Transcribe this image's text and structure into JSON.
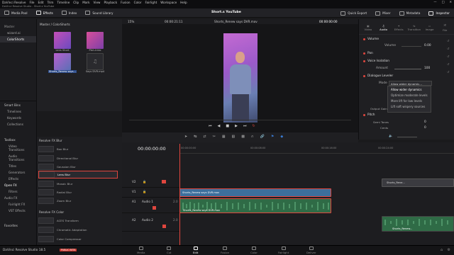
{
  "titlebar": {
    "app": "DaVinci Resolve Studio - Short.s YouTube",
    "menus": [
      "DaVinci Resolve",
      "File",
      "Edit",
      "Trim",
      "Timeline",
      "Clip",
      "Mark",
      "View",
      "Playback",
      "Fusion",
      "Color",
      "Fairlight",
      "Workspace",
      "Help"
    ]
  },
  "toolbar": {
    "left": [
      "Media Pool",
      "Effects",
      "Index",
      "Sound Library"
    ],
    "project_title": "Short.s YouTube",
    "right": [
      "Quick Export",
      "Mixer",
      "Metadata",
      "Inspector"
    ]
  },
  "left_pane": {
    "items": [
      "Master",
      "wizard.ai",
      "ColorShorts"
    ],
    "smart_bins_title": "Smart Bins",
    "smart_bins": [
      "Timelines",
      "Keywords",
      "Collections"
    ]
  },
  "media_pool": {
    "breadcrumb": "Master / ColorShorts",
    "clips": [
      "Lens Short",
      "Plsh-Intro",
      "Shorts_Renew says...",
      "Says DVR.mp4"
    ]
  },
  "viewer": {
    "zoom": "15%",
    "timecode_left": "00:00:21:11",
    "clip_name": "Shorts_Renew says DVR.mov",
    "timecode_right": "00:00:00:00"
  },
  "inspector": {
    "tabs": [
      "Video",
      "Audio",
      "Effects",
      "Transition",
      "Image",
      "File"
    ],
    "sections": [
      {
        "name": "Volume"
      },
      {
        "name": "Pan"
      },
      {
        "name": "Voice Isolation"
      },
      {
        "name": "Dialogue Leveler"
      },
      {
        "name": "Pitch"
      }
    ],
    "volume_label": "Volume",
    "volume_value": "0.00",
    "amount_label": "Amount",
    "amount_value": "100",
    "mode_label": "Mode",
    "mode_value": "Allow wider dynamic...",
    "output_gain_label": "Output Gain",
    "semitones_label": "Semi Tones",
    "semitones_value": "0",
    "cents_label": "Cents",
    "cents_value": "0",
    "mode_options": [
      "Allow wider dynamics",
      "Optimize moderate levels",
      "More lift for low levels",
      "Lift soft wispery sources"
    ]
  },
  "effects": {
    "sidebar": [
      "Toolbox",
      "Video Transitions",
      "Audio Transitions",
      "Titles",
      "Generators",
      "Effects",
      "Open FX",
      "Filters",
      "Audio FX",
      "Fairlight FX",
      "VST Effects"
    ],
    "favorites": "Favorites",
    "group1": "Resolve FX Blur",
    "blur": [
      "Box Blur",
      "Directional Blur",
      "Gaussian Blur",
      "Lens Blur",
      "Mosaic Blur",
      "Radial Blur",
      "Zoom Blur"
    ],
    "group2": "Resolve FX Color",
    "color": [
      "ACES Transform",
      "Chromatic Adaptation",
      "Color Compressor"
    ]
  },
  "timeline": {
    "timecode": "00:00:00:00",
    "ruler": [
      "00:00:00:00",
      "00:00:08:00",
      "00:00:16:00",
      "00:00:24:00"
    ],
    "tracks": [
      {
        "id": "V2",
        "name": ""
      },
      {
        "id": "V1",
        "name": ""
      },
      {
        "id": "A1",
        "name": "Audio 1",
        "level": "2.0"
      },
      {
        "id": "A2",
        "name": "Audio 2",
        "level": "2.0"
      }
    ],
    "clips": {
      "v1": "Shorts_Renew says DVR.mov",
      "a1": "Shorts_Renew says DVR.mov",
      "v2_right": "Shorts_Rene...",
      "a2_right": "Shorts_Renew..."
    }
  },
  "bottom": {
    "brand": "DaVinci Resolve Studio 18.5",
    "badge": "PUBLIC BETA",
    "pages": [
      "Media",
      "Cut",
      "Edit",
      "Fusion",
      "Color",
      "Fairlight",
      "Deliver"
    ],
    "active_page": "Edit"
  }
}
